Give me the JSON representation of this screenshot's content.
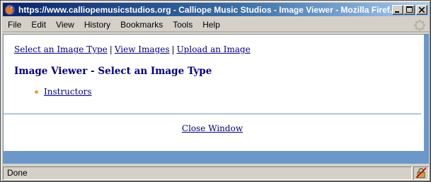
{
  "window": {
    "title": "https://www.calliopemusicstudios.org - Calliope Music Studios - Image Viewer - Mozilla Firef...",
    "minimize_glyph": "_",
    "maximize_glyph": "□",
    "close_glyph": "×"
  },
  "menubar": {
    "items": [
      "File",
      "Edit",
      "View",
      "History",
      "Bookmarks",
      "Tools",
      "Help"
    ]
  },
  "page": {
    "nav": {
      "select_type": "Select an Image Type",
      "separator": "|",
      "view_images": "View Images",
      "upload_image": "Upload an Image"
    },
    "heading": "Image Viewer - Select an Image Type",
    "image_types": [
      "Instructors"
    ],
    "close_window": "Close Window"
  },
  "statusbar": {
    "text": "Done"
  },
  "colors": {
    "link": "#000080",
    "heading": "#000080",
    "frame_blue": "#6b97c9",
    "bullet": "#f0a030"
  },
  "icons": {
    "app": "firefox-icon",
    "throbber": "throbber-icon",
    "status": "security-lock-icon"
  }
}
